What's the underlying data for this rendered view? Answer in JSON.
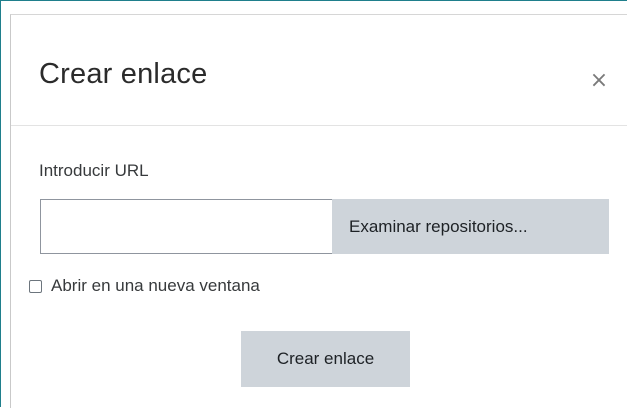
{
  "dialog": {
    "title": "Crear enlace",
    "close_glyph": "×",
    "close_icon": "close-icon"
  },
  "form": {
    "url_label": "Introducir URL",
    "url_value": "",
    "url_placeholder": "",
    "browse_button": "Examinar repositorios...",
    "new_window_label": "Abrir en una nueva ventana",
    "new_window_checked": false,
    "submit_button": "Crear enlace"
  },
  "colors": {
    "frame_border": "#1f7f8c",
    "button_bg": "#ced4da",
    "text": "#373a3c"
  }
}
